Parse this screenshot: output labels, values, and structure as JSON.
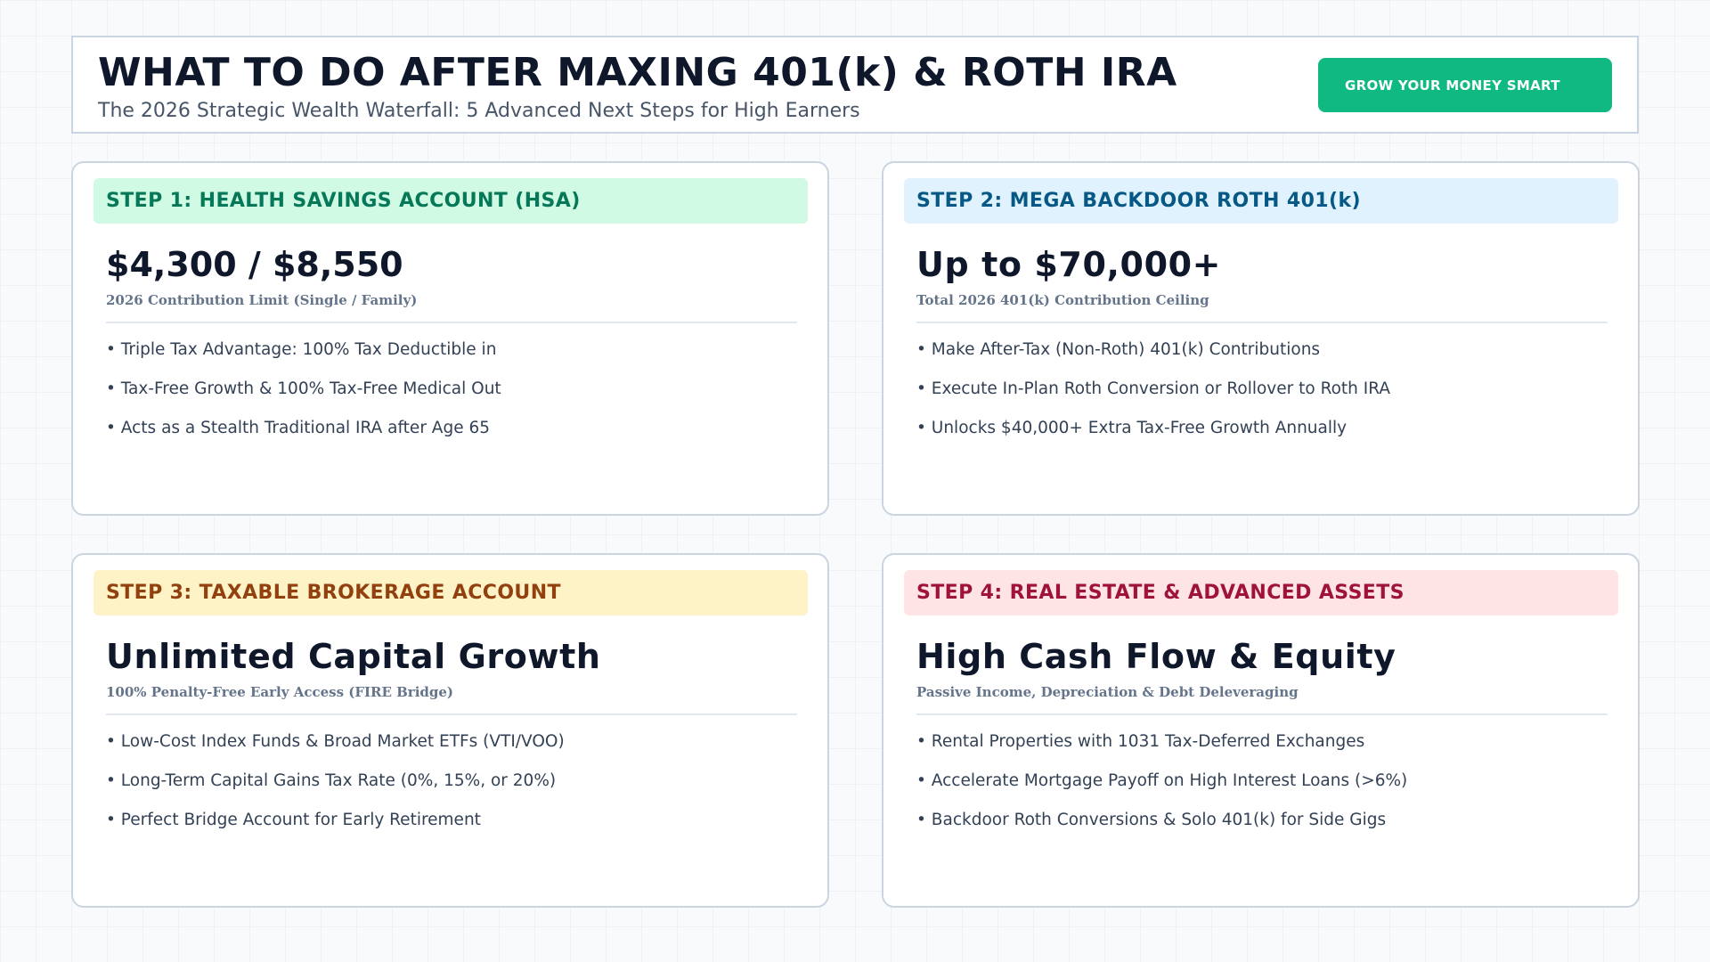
{
  "header": {
    "title": "WHAT TO DO AFTER MAXING 401(k) & ROTH IRA",
    "subtitle": "The 2026 Strategic Wealth Waterfall: 5 Advanced Next Steps for High Earners",
    "cta_label": "GROW YOUR MONEY SMART"
  },
  "cards": [
    {
      "step_label": "STEP 1: HEALTH SAVINGS ACCOUNT (HSA)",
      "big_value": "$4,300 / $8,550",
      "caption": "2026 Contribution Limit (Single / Family)",
      "bullets": [
        "• Triple Tax Advantage: 100% Tax Deductible in",
        "• Tax-Free Growth & 100% Tax-Free Medical Out",
        "• Acts as a Stealth Traditional IRA after Age 65"
      ]
    },
    {
      "step_label": "STEP 2: MEGA BACKDOOR ROTH 401(k)",
      "big_value": "Up to $70,000+",
      "caption": "Total 2026 401(k) Contribution Ceiling",
      "bullets": [
        "• Make After-Tax (Non-Roth) 401(k) Contributions",
        "• Execute In-Plan Roth Conversion or Rollover to Roth IRA",
        "• Unlocks $40,000+ Extra Tax-Free Growth Annually"
      ]
    },
    {
      "step_label": "STEP 3: TAXABLE BROKERAGE ACCOUNT",
      "big_value": "Unlimited Capital Growth",
      "caption": "100% Penalty-Free Early Access (FIRE Bridge)",
      "bullets": [
        "• Low-Cost Index Funds & Broad Market ETFs (VTI/VOO)",
        "• Long-Term Capital Gains Tax Rate (0%, 15%, or 20%)",
        "• Perfect Bridge Account for Early Retirement"
      ]
    },
    {
      "step_label": "STEP 4: REAL ESTATE & ADVANCED ASSETS",
      "big_value": "High Cash Flow & Equity",
      "caption": "Passive Income, Depreciation & Debt Deleveraging",
      "bullets": [
        "• Rental Properties with 1031 Tax-Deferred Exchanges",
        "• Accelerate Mortgage Payoff on High Interest Loans (>6%)",
        "• Backdoor Roth Conversions & Solo 401(k) for Side Gigs"
      ]
    }
  ],
  "colors": {
    "accent_button": "#10b981",
    "step1_bg": "#d1fae5",
    "step1_text": "#047857",
    "step2_bg": "#e0f2fe",
    "step2_text": "#075985",
    "step3_bg": "#fef3c7",
    "step3_text": "#92400e",
    "step4_bg": "#ffe4e6",
    "step4_text": "#9f1239"
  }
}
